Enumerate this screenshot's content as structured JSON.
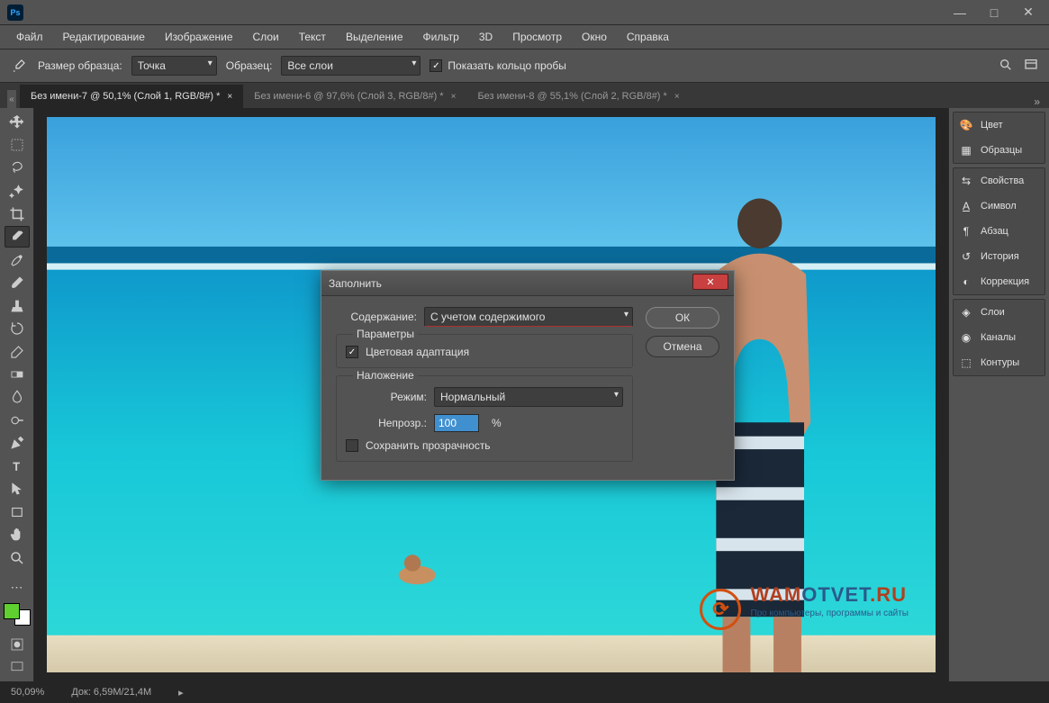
{
  "app": {
    "logo": "Ps"
  },
  "window_controls": {
    "minimize": "—",
    "maximize": "□",
    "close": "✕"
  },
  "menu": [
    "Файл",
    "Редактирование",
    "Изображение",
    "Слои",
    "Текст",
    "Выделение",
    "Фильтр",
    "3D",
    "Просмотр",
    "Окно",
    "Справка"
  ],
  "options": {
    "sample_size_label": "Размер образца:",
    "sample_size_value": "Точка",
    "sample_label": "Образец:",
    "sample_value": "Все слои",
    "show_ring": "Показать кольцо пробы"
  },
  "tabs": [
    {
      "label": "Без имени-7 @ 50,1% (Слой 1, RGB/8#) *",
      "active": true
    },
    {
      "label": "Без имени-6 @ 97,6% (Слой 3, RGB/8#) *",
      "active": false
    },
    {
      "label": "Без имени-8 @ 55,1% (Слой 2, RGB/8#) *",
      "active": false
    }
  ],
  "tools": [
    "move",
    "marquee",
    "lasso",
    "magic-wand",
    "crop",
    "eyedropper",
    "healing",
    "brush",
    "clone",
    "history-brush",
    "eraser",
    "gradient",
    "blur",
    "dodge",
    "pen",
    "type",
    "path-select",
    "rectangle",
    "hand",
    "zoom"
  ],
  "panels": {
    "group1": [
      {
        "icon": "⬤",
        "label": "Цвет"
      },
      {
        "icon": "▦",
        "label": "Образцы"
      }
    ],
    "group2": [
      {
        "icon": "⇆",
        "label": "Свойства"
      },
      {
        "icon": "A",
        "label": "Символ"
      },
      {
        "icon": "¶",
        "label": "Абзац"
      },
      {
        "icon": "↺",
        "label": "История"
      },
      {
        "icon": "◐",
        "label": "Коррекция"
      }
    ],
    "group3": [
      {
        "icon": "◈",
        "label": "Слои"
      },
      {
        "icon": "◉",
        "label": "Каналы"
      },
      {
        "icon": "⬡",
        "label": "Контуры"
      }
    ]
  },
  "status": {
    "zoom": "50,09%",
    "doc": "Док: 6,59M/21,4M"
  },
  "dialog": {
    "title": "Заполнить",
    "content_label": "Содержание:",
    "content_value": "С учетом содержимого",
    "params_label": "Параметры",
    "color_adapt": "Цветовая адаптация",
    "overlay_label": "Наложение",
    "mode_label": "Режим:",
    "mode_value": "Нормальный",
    "opacity_label": "Непрозр.:",
    "opacity_value": "100",
    "opacity_unit": "%",
    "preserve": "Сохранить прозрачность",
    "ok": "ОК",
    "cancel": "Отмена"
  },
  "watermark": {
    "brand_prefix": "WAM",
    "brand_main": "OTVET",
    "brand_suffix": ".RU",
    "tagline": "Про компьютеры, программы и сайты"
  }
}
